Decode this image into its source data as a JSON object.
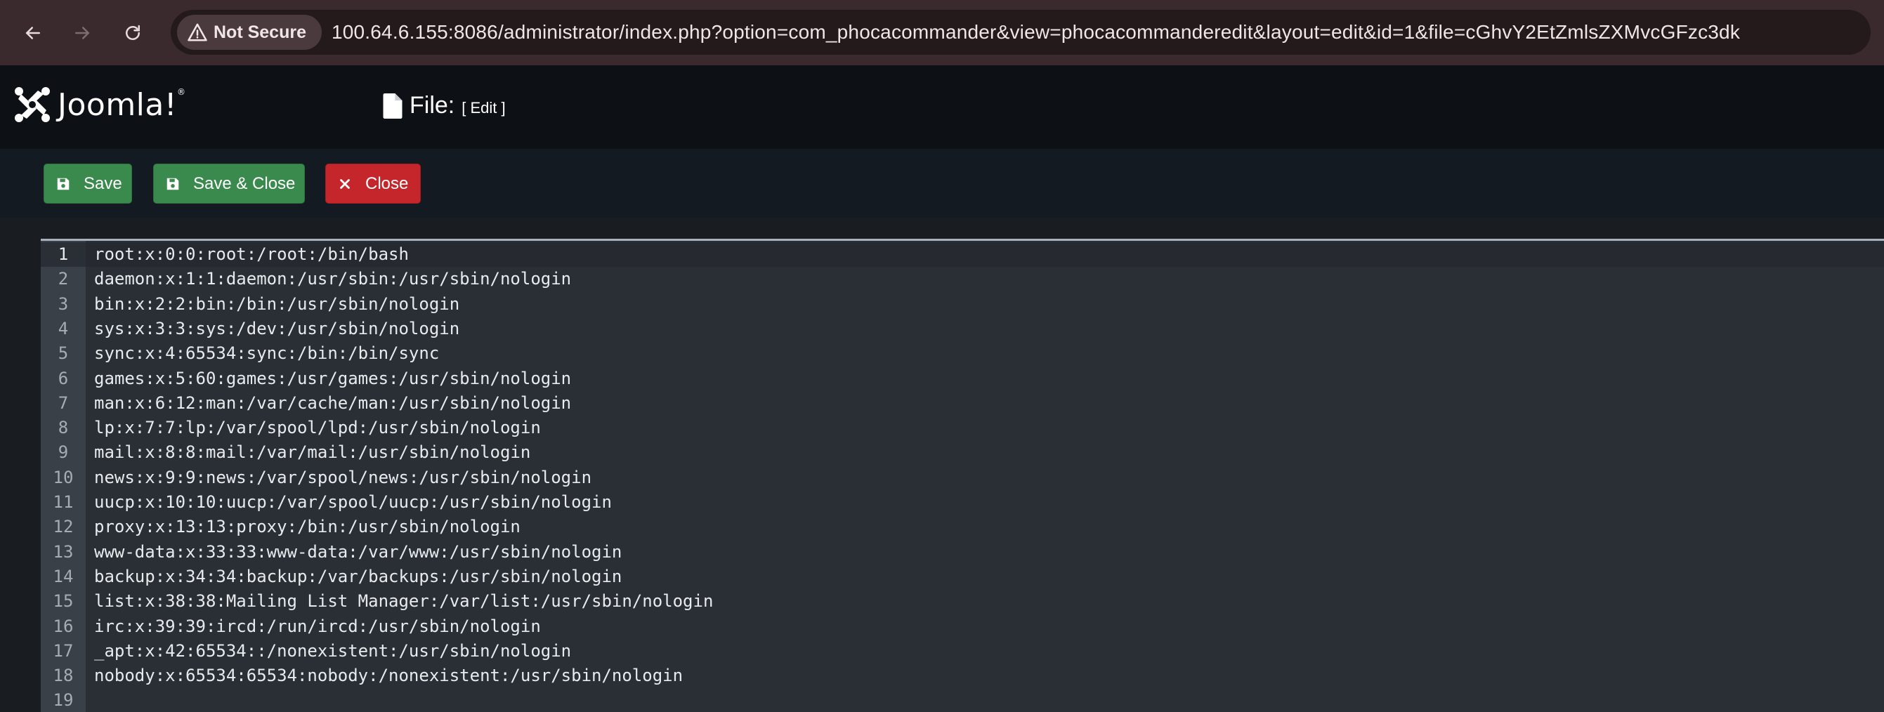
{
  "browser": {
    "security_label": "Not Secure",
    "url": "100.64.6.155:8086/administrator/index.php?option=com_phocacommander&view=phocacommanderedit&layout=edit&id=1&file=cGhvY2EtZmlsZXMvcGFzc3dk"
  },
  "header": {
    "logo_text": "Joomla!",
    "logo_mark": "®",
    "title": "File:",
    "subtitle": "[ Edit ]"
  },
  "toolbar": {
    "save_label": "Save",
    "save_close_label": "Save & Close",
    "close_label": "Close"
  },
  "editor": {
    "lines": [
      "root:x:0:0:root:/root:/bin/bash",
      "daemon:x:1:1:daemon:/usr/sbin:/usr/sbin/nologin",
      "bin:x:2:2:bin:/bin:/usr/sbin/nologin",
      "sys:x:3:3:sys:/dev:/usr/sbin/nologin",
      "sync:x:4:65534:sync:/bin:/bin/sync",
      "games:x:5:60:games:/usr/games:/usr/sbin/nologin",
      "man:x:6:12:man:/var/cache/man:/usr/sbin/nologin",
      "lp:x:7:7:lp:/var/spool/lpd:/usr/sbin/nologin",
      "mail:x:8:8:mail:/var/mail:/usr/sbin/nologin",
      "news:x:9:9:news:/var/spool/news:/usr/sbin/nologin",
      "uucp:x:10:10:uucp:/var/spool/uucp:/usr/sbin/nologin",
      "proxy:x:13:13:proxy:/bin:/usr/sbin/nologin",
      "www-data:x:33:33:www-data:/var/www:/usr/sbin/nologin",
      "backup:x:34:34:backup:/var/backups:/usr/sbin/nologin",
      "list:x:38:38:Mailing List Manager:/var/list:/usr/sbin/nologin",
      "irc:x:39:39:ircd:/run/ircd:/usr/sbin/nologin",
      "_apt:x:42:65534::/nonexistent:/usr/sbin/nologin",
      "nobody:x:65534:65534:nobody:/nonexistent:/usr/sbin/nologin",
      ""
    ],
    "line_numbers": [
      "1",
      "2",
      "3",
      "4",
      "5",
      "6",
      "7",
      "8",
      "9",
      "10",
      "11",
      "12",
      "13",
      "14",
      "15",
      "16",
      "17",
      "18",
      "19"
    ],
    "active_line": 1
  }
}
